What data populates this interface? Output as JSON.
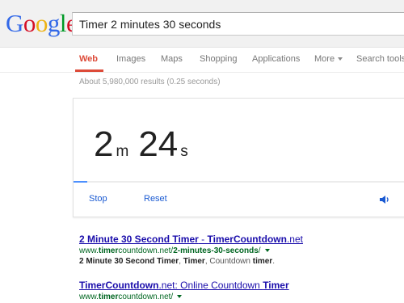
{
  "logo": {
    "letters": [
      "G",
      "o",
      "o",
      "g",
      "l",
      "e"
    ]
  },
  "search": {
    "query": "Timer 2 minutes 30 seconds"
  },
  "nav": {
    "items": [
      {
        "label": "Web",
        "active": true
      },
      {
        "label": "Images"
      },
      {
        "label": "Maps"
      },
      {
        "label": "Shopping"
      },
      {
        "label": "Applications"
      },
      {
        "label": "More"
      },
      {
        "label": "Search tools"
      }
    ]
  },
  "stats": {
    "text": "About 5,980,000 results (0.25 seconds)"
  },
  "timer": {
    "minutes": "2",
    "minutes_unit": "m",
    "seconds": "24",
    "seconds_unit": "s",
    "progress_fraction": 0.04,
    "stop_label": "Stop",
    "reset_label": "Reset"
  },
  "results": [
    {
      "title_parts": [
        "2 Minute 30 Second Timer",
        " - ",
        "TimerCountdown",
        ".net"
      ],
      "url_parts": [
        "www.",
        "timer",
        "countdown.net/",
        "2-minutes-30-seconds",
        "/"
      ],
      "snippet_parts": [
        "2 Minute 30 Second Timer",
        ", ",
        "Timer",
        ", Countdown ",
        "timer",
        "."
      ]
    },
    {
      "title_parts": [
        "TimerCountdown",
        ".net: Online Countdown ",
        "Timer"
      ],
      "url_parts": [
        "www.",
        "timer",
        "countdown.net/"
      ]
    }
  ],
  "colors": {
    "accent_red": "#dd4b39",
    "link_blue": "#1a0dab",
    "url_green": "#006621",
    "progress_blue": "#4d90fe"
  }
}
